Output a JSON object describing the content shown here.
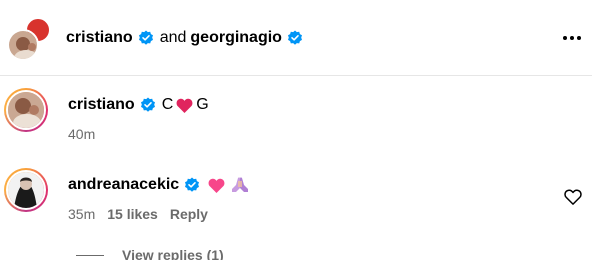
{
  "header": {
    "user1": "cristiano",
    "conjunction": "and",
    "user2": "georginagio"
  },
  "comments": [
    {
      "username": "cristiano",
      "text_before": "C",
      "text_after": "G",
      "time": "40m"
    },
    {
      "username": "andreanacekic",
      "time": "35m",
      "likes": "15 likes",
      "reply_label": "Reply"
    }
  ],
  "view_replies": "View replies (1)",
  "icons": {
    "verified": "verified-badge-icon",
    "more": "more-options-icon",
    "heart_emoji": "red-heart-icon",
    "pink_heart_emoji": "pink-heart-icon",
    "pray_emoji": "folded-hands-icon",
    "like": "heart-outline-icon"
  },
  "colors": {
    "verified": "#0095f6",
    "heart": "#e0245e",
    "secondary_text": "#6b6b6b"
  }
}
